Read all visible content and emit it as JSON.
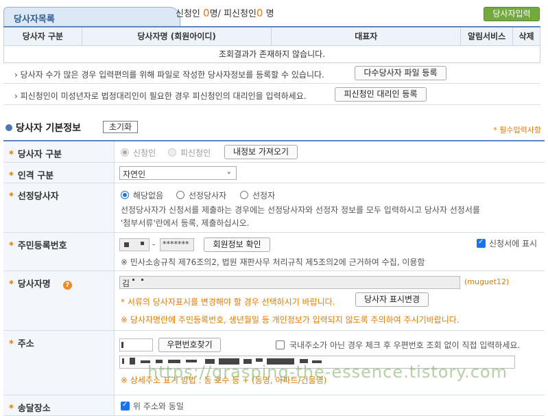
{
  "header": {
    "tab_title": "당사자목록",
    "applicant_label": "신청인",
    "applicant_count": "0",
    "unit1": "명/",
    "non_applicant_label": "피신청인",
    "non_applicant_count": "0",
    "unit2": "명",
    "add_button": "당사자입력"
  },
  "list_table": {
    "columns": [
      "당사자 구분",
      "당사자명 (회원아이디)",
      "대표자",
      "알림서비스",
      "삭제"
    ],
    "empty_message": "조회결과가 존재하지 않습니다."
  },
  "notices": [
    {
      "text": "당사자 수가 많은 경우 입력편의를 위해 파일로 작성한 당사자정보를 등록할 수 있습니다.",
      "button": "다수당사자 파일 등록"
    },
    {
      "text": "피신청인이 미성년자로 법정대리인이 필요한 경우 피신청인의 대리인을 입력하세요.",
      "button": "피신청인 대리인 등록"
    }
  ],
  "section": {
    "title": "당사자 기본정보",
    "reset_button": "초기화",
    "required_note": "* 필수입력사항"
  },
  "form": {
    "party_type": {
      "label": "당사자 구분",
      "option1": "신청인",
      "option2": "피신청인",
      "selected": "신청인",
      "fetch_button": "내정보 가져오기"
    },
    "person_type": {
      "label": "인격 구분",
      "value": "자연인"
    },
    "designated": {
      "label": "선정당사자",
      "option1": "해당없음",
      "option2": "선정당사자",
      "option3": "선정자",
      "selected": "해당없음",
      "desc1": "선정당사자가 신청서를 제출하는 경우에는 선정당사자와 선정자 정보를 모두 입력하시고 당사자 선정서를",
      "desc2": "'첨부서류'란에서 등록, 제출하십시오."
    },
    "resident_no": {
      "label": "주민등록번호",
      "dash": "-",
      "second_value": "*******",
      "verify_button": "회원정보 확인",
      "show_checkbox": "신청서에 표시",
      "show_checked": true,
      "note": "※ 민사소송규칙 제76조의2, 법원 재판사무 처리규칙 제5조의2에 근거하여 수집, 이용함"
    },
    "party_name": {
      "label": "당사자명",
      "value": "김",
      "member_id": "(muguet12)",
      "change_note": "* 서류의 당사자표시를 변경해야 할 경우 선택하시기 바랍니다.",
      "change_button": "당사자 표시변경",
      "warn_note": "※ 당사자명란에 주민등록번호, 생년월일 등 개인정보가 입력되지 않도록 주의하여 주시기바랍니다."
    },
    "address": {
      "label": "주소",
      "zip_button": "우편번호찾기",
      "foreign_checkbox": "국내주소가 아닌 경우 체크 후 우편번호 조회 없이 직접 입력하세요.",
      "foreign_checked": false,
      "note": "※ 상세주소 표기 방법 : 동 호수 등 + (동명, 아파트/건물명)"
    },
    "delivery": {
      "label": "송달장소",
      "same_checkbox": "위 주소와 동일",
      "same_checked": true
    }
  },
  "watermark": "https://grasping-the-essence.tistory.com",
  "colors": {
    "accent": "#5a86c0",
    "orange": "#e57b00",
    "green": "#73a93f"
  }
}
